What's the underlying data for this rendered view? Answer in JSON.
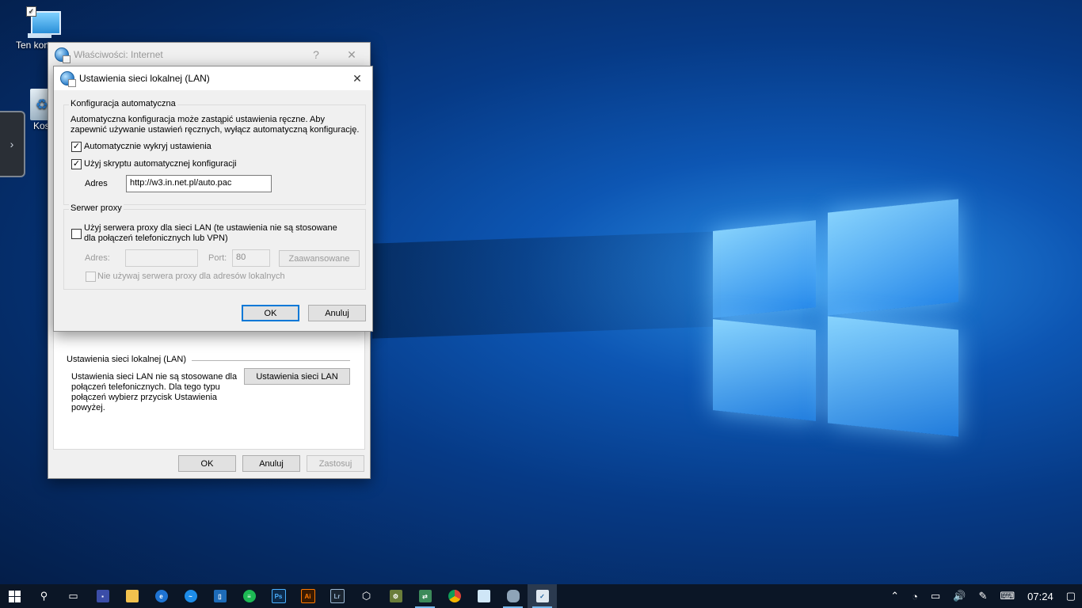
{
  "desktop": {
    "icons": [
      {
        "label": "Ten kom"
      },
      {
        "label": "Kos"
      }
    ]
  },
  "outer_dialog": {
    "title": "Właściwości: Internet",
    "help_glyph": "?",
    "close_glyph": "✕",
    "lan_section_title": "Ustawienia sieci lokalnej (LAN)",
    "lan_description": "Ustawienia sieci LAN nie są stosowane dla połączeń telefonicznych. Dla tego typu połączeń wybierz przycisk Ustawienia powyżej.",
    "lan_button": "Ustawienia sieci LAN",
    "ok": "OK",
    "cancel": "Anuluj",
    "apply": "Zastosuj"
  },
  "lan_dialog": {
    "title": "Ustawienia sieci lokalnej (LAN)",
    "close_glyph": "✕",
    "auto_group": {
      "legend": "Konfiguracja automatyczna",
      "description": "Automatyczna konfiguracja może zastąpić ustawienia ręczne. Aby zapewnić używanie ustawień ręcznych, wyłącz automatyczną konfigurację.",
      "auto_detect": {
        "label": "Automatycznie wykryj ustawienia",
        "checked": true
      },
      "use_script": {
        "label": "Użyj skryptu automatycznej konfiguracji",
        "checked": true
      },
      "address_label": "Adres",
      "address_value": "http://w3.in.net.pl/auto.pac"
    },
    "proxy_group": {
      "legend": "Serwer proxy",
      "use_proxy": {
        "label": "Użyj serwera proxy dla sieci LAN (te ustawienia nie są stosowane dla połączeń telefonicznych lub VPN)",
        "checked": false
      },
      "address_label": "Adres:",
      "address_value": "",
      "port_label": "Port:",
      "port_value": "80",
      "advanced_button": "Zaawansowane",
      "bypass_local": {
        "label": "Nie używaj serwera proxy dla adresów lokalnych",
        "checked": false
      }
    },
    "ok": "OK",
    "cancel": "Anuluj"
  },
  "taskbar": {
    "icons": [
      "start-icon",
      "search-icon",
      "task-view-icon",
      "save-icon",
      "file-explorer-icon",
      "edge-icon",
      "messenger-icon",
      "app-icon",
      "spotify-icon",
      "photoshop-icon",
      "illustrator-icon",
      "lightroom-icon",
      "virtualbox-icon",
      "network-app-icon",
      "network-app2-icon",
      "chrome-icon",
      "notepad-icon",
      "cloud-icon",
      "internet-options-icon"
    ],
    "badges": {
      "photoshop": "Ps",
      "illustrator": "Ai",
      "lightroom": "Lr"
    },
    "clock": "07:24"
  }
}
